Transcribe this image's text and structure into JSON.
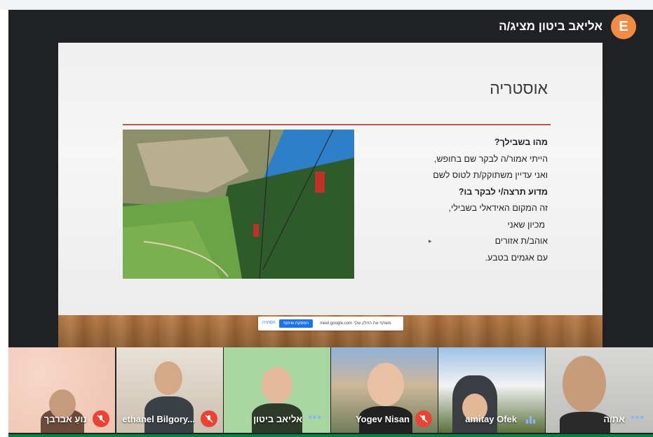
{
  "presenter": {
    "name": "אליאב ביטון מציג/ה",
    "avatar_letter": "E",
    "avatar_color": "#f28b44"
  },
  "slide": {
    "title": "אוסטריה",
    "lines": [
      "מהו בשבילך?",
      "הייתי אמור/ה לבקר שם בחופש,",
      "ואני עדיין משתוקק/ת לטוס לשם",
      "מדוע תרצה/י  לבקר בו?",
      "זה המקום האידאלי בשבילי,",
      "מכיון שאני",
      "אוהב/ת אזורים",
      "עם אגמים בטבע."
    ],
    "accent_color": "#c0504d"
  },
  "share_bar": {
    "message": "meet.google.com משתף את החלון שלך",
    "stop_label": "הפסקת שיתוף",
    "hide_label": "הסתרה"
  },
  "participants": [
    {
      "name": "נועַ אברבך",
      "muted": true
    },
    {
      "name": "ethanel Bilgory...",
      "muted": true
    },
    {
      "name": "אליאב ביטון",
      "muted": false,
      "status_icon": "more-icon"
    },
    {
      "name": "Yogev Nisan",
      "muted": true
    },
    {
      "name": "amitay Ofek",
      "muted": false,
      "status_icon": "speaking-icon"
    },
    {
      "name": "את/ה",
      "muted": false,
      "status_icon": "more-icon"
    }
  ],
  "colors": {
    "muted_red": "#ea4335",
    "meet_blue": "#1a73e8",
    "stage_bg": "#202124"
  }
}
